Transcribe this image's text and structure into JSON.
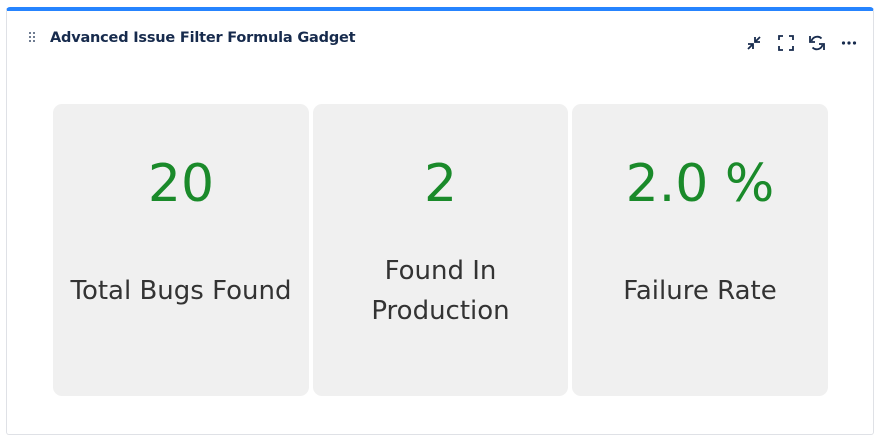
{
  "gadget": {
    "title": "Advanced Issue Filter Formula Gadget",
    "accent_color": "#2684ff",
    "actions": [
      {
        "name": "minimize",
        "icon": "minimize-icon"
      },
      {
        "name": "fullscreen",
        "icon": "fullscreen-icon"
      },
      {
        "name": "refresh",
        "icon": "refresh-icon"
      },
      {
        "name": "more",
        "icon": "more-icon"
      }
    ]
  },
  "metrics": [
    {
      "value": "20",
      "label_line1": "Total Bugs Found",
      "label_line2": ""
    },
    {
      "value": "2",
      "label_line1": "Found In",
      "label_line2": "Production"
    },
    {
      "value": "2.0 %",
      "label_line1": "Failure Rate",
      "label_line2": ""
    }
  ],
  "colors": {
    "value_color": "#1a8a2a",
    "card_background": "#f0f0f0",
    "label_color": "#333333"
  }
}
